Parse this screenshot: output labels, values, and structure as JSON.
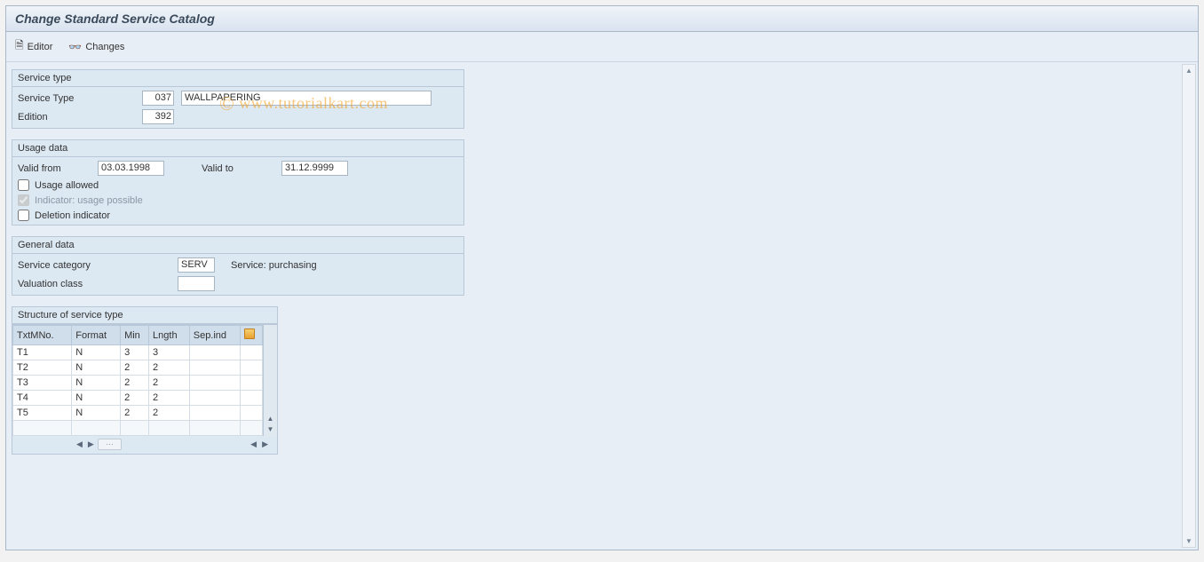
{
  "header": {
    "title": "Change Standard Service Catalog"
  },
  "toolbar": {
    "editor": "Editor",
    "changes": "Changes"
  },
  "watermark": "www.tutorialkart.com",
  "serviceType": {
    "legend": "Service type",
    "serviceTypeLabel": "Service Type",
    "serviceTypeCode": "037",
    "serviceTypeDesc": "WALLPAPERING",
    "editionLabel": "Edition",
    "editionValue": "392"
  },
  "usage": {
    "legend": "Usage data",
    "validFromLabel": "Valid from",
    "validFrom": "03.03.1998",
    "validToLabel": "Valid to",
    "validTo": "31.12.9999",
    "usageAllowed": "Usage allowed",
    "indicator": "Indicator: usage possible",
    "deletion": "Deletion indicator"
  },
  "general": {
    "legend": "General data",
    "categoryLabel": "Service category",
    "categoryValue": "SERV",
    "categoryDesc": "Service: purchasing",
    "valClassLabel": "Valuation class",
    "valClassValue": ""
  },
  "structure": {
    "legend": "Structure of service type",
    "cols": {
      "c1": "TxtMNo.",
      "c2": "Format",
      "c3": "Min",
      "c4": "Lngth",
      "c5": "Sep.ind"
    },
    "rows": [
      {
        "c1": "T1",
        "c2": "N",
        "c3": "3",
        "c4": "3",
        "c5": ""
      },
      {
        "c1": "T2",
        "c2": "N",
        "c3": "2",
        "c4": "2",
        "c5": ""
      },
      {
        "c1": "T3",
        "c2": "N",
        "c3": "2",
        "c4": "2",
        "c5": ""
      },
      {
        "c1": "T4",
        "c2": "N",
        "c3": "2",
        "c4": "2",
        "c5": ""
      },
      {
        "c1": "T5",
        "c2": "N",
        "c3": "2",
        "c4": "2",
        "c5": ""
      }
    ]
  }
}
